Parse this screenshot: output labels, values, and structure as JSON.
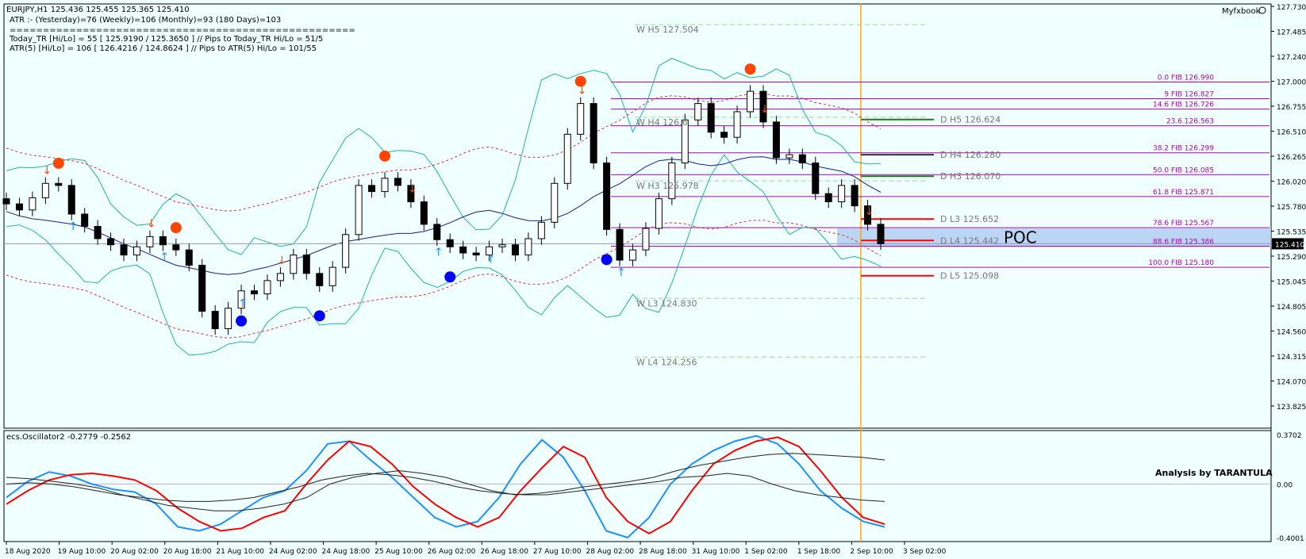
{
  "header": {
    "symbol_line": "EURJPY,H1  125.436 125.455 125.365 125.410",
    "atr_line": "ATR :- (Yesterday)=76      (Weekly)=106      (Monthly)=93      (180 Days)=103",
    "separator": "====================================================",
    "today_tr_line": "Today_TR [Hi/Lo] = 55 [ 125.9190 / 125.3650 ]  // Pips to Today_TR Hi/Lo  = 51/5",
    "atr5_line": "ATR(5)      [Hi/Lo] = 106 [ 126.4216 / 124.8624 ]  //  Pips to ATR(5) Hi/Lo      = 101/55"
  },
  "brand": "Myfxbook",
  "oscillator_label": "ecs.Oscillator2 -0.2779 -0.2562",
  "analysis_label": "Analysis by TARANTULA",
  "poc_label": "POC",
  "current_price": "125.410",
  "colors": {
    "background": "#f0ffff",
    "up_arrow": "#1e90ff",
    "down_arrow": "#ff4500",
    "fib": "#b000b0",
    "pivot_line": "#ff0000",
    "vline": "#ffa500",
    "blue_series": "#1e90ff",
    "red_series": "#ff0000"
  },
  "chart_data": [
    {
      "type": "candlestick",
      "price_axis": {
        "ylim": [
          123.825,
          127.73
        ],
        "tick_labels": [
          "127.730",
          "127.485",
          "127.240",
          "127.000",
          "126.755",
          "126.510",
          "126.265",
          "126.020",
          "125.780",
          "125.535",
          "125.290",
          "125.045",
          "124.805",
          "124.560",
          "124.315",
          "124.070",
          "123.825"
        ]
      },
      "time_axis": {
        "tick_labels": [
          "18 Aug 2020",
          "19 Aug 10:00",
          "20 Aug 02:00",
          "20 Aug 18:00",
          "21 Aug 10:00",
          "24 Aug 02:00",
          "24 Aug 18:00",
          "25 Aug 10:00",
          "26 Aug 02:00",
          "26 Aug 18:00",
          "27 Aug 10:00",
          "28 Aug 02:00",
          "28 Aug 18:00",
          "31 Aug 10:00",
          "1 Sep 02:00",
          "1 Sep 18:00",
          "2 Sep 10:00",
          "3 Sep 02:00"
        ]
      },
      "close_series": [
        125.8,
        125.74,
        125.86,
        126.0,
        125.98,
        125.7,
        125.58,
        125.46,
        125.4,
        125.3,
        125.38,
        125.48,
        125.4,
        125.35,
        125.2,
        124.75,
        124.58,
        124.78,
        124.95,
        124.92,
        125.05,
        125.12,
        125.3,
        125.12,
        125.0,
        125.18,
        125.5,
        125.98,
        125.92,
        126.05,
        125.98,
        125.82,
        125.6,
        125.45,
        125.38,
        125.32,
        125.3,
        125.38,
        125.4,
        125.3,
        125.46,
        125.62,
        126.0,
        126.48,
        126.78,
        126.2,
        125.55,
        125.25,
        125.35,
        125.56,
        125.85,
        126.2,
        126.62,
        126.78,
        126.5,
        126.45,
        126.7,
        126.9,
        126.6,
        126.25,
        126.28,
        126.2,
        125.9,
        125.82,
        125.98,
        125.78,
        125.6,
        125.41
      ],
      "ohlc_header": {
        "open": 125.436,
        "high": 125.455,
        "low": 125.365,
        "close": 125.41
      },
      "fibonacci_levels": [
        {
          "label": "0.0 FIB 126.990",
          "value": 126.99
        },
        {
          "label": "9 FIB 126.827",
          "value": 126.827
        },
        {
          "label": "14.6 FIB 126.726",
          "value": 126.726
        },
        {
          "label": "23.6  126.563",
          "value": 126.563
        },
        {
          "label": "38.2 FIB 126.299",
          "value": 126.299
        },
        {
          "label": "50.0 FIB 126.085",
          "value": 126.085
        },
        {
          "label": "61.8 FIB 125.871",
          "value": 125.871
        },
        {
          "label": "78.6 FIB 125.567",
          "value": 125.567
        },
        {
          "label": "88.6 FIB 125.386",
          "value": 125.386
        },
        {
          "label": "100.0 FIB 125.180",
          "value": 125.18
        }
      ],
      "weekly_pivots": [
        {
          "label": "W  H5 127.504",
          "value": 127.504
        },
        {
          "label": "W  H4 126.6",
          "value": 126.6
        },
        {
          "label": "W  H3 125.978",
          "value": 125.978
        },
        {
          "label": "W  L3 124.830",
          "value": 124.83
        },
        {
          "label": "W  L4 124.256",
          "value": 124.256
        }
      ],
      "daily_pivots": [
        {
          "label": "D  H5 126.624",
          "value": 126.624
        },
        {
          "label": "D  H4 126.280",
          "value": 126.28
        },
        {
          "label": "D  H3 126.070",
          "value": 126.07
        },
        {
          "label": "D  L3 125.652",
          "value": 125.652
        },
        {
          "label": "D  L4 125.442",
          "value": 125.442
        },
        {
          "label": "D  L5 125.098",
          "value": 125.098
        }
      ],
      "poc": {
        "low": 125.38,
        "high": 125.56
      }
    },
    {
      "type": "line",
      "name": "ecs.Oscillator2",
      "ylim": [
        -0.4001,
        0.3702
      ],
      "tick_labels": [
        "0.3702",
        "0.00",
        "-0.4001"
      ],
      "series": [
        {
          "name": "blue",
          "color": "#1e90ff",
          "values": [
            -0.1,
            0.02,
            0.09,
            0.06,
            0.0,
            -0.04,
            -0.06,
            -0.15,
            -0.32,
            -0.35,
            -0.3,
            -0.2,
            -0.1,
            -0.05,
            0.1,
            0.3,
            0.32,
            0.18,
            0.05,
            -0.1,
            -0.25,
            -0.32,
            -0.28,
            -0.1,
            0.15,
            0.33,
            0.2,
            -0.05,
            -0.35,
            -0.4,
            -0.25,
            0.0,
            0.15,
            0.25,
            0.32,
            0.36,
            0.3,
            0.15,
            -0.05,
            -0.18,
            -0.28,
            -0.32
          ]
        },
        {
          "name": "red",
          "color": "#ff0000",
          "values": [
            -0.15,
            -0.05,
            0.03,
            0.07,
            0.08,
            0.06,
            0.03,
            -0.05,
            -0.18,
            -0.28,
            -0.35,
            -0.33,
            -0.25,
            -0.2,
            0.0,
            0.18,
            0.32,
            0.28,
            0.15,
            -0.02,
            -0.15,
            -0.25,
            -0.32,
            -0.25,
            -0.05,
            0.12,
            0.28,
            0.2,
            -0.1,
            -0.28,
            -0.37,
            -0.28,
            -0.05,
            0.15,
            0.25,
            0.32,
            0.35,
            0.28,
            0.1,
            -0.1,
            -0.25,
            -0.3
          ]
        },
        {
          "name": "black-1",
          "color": "#222222",
          "values": [
            0.05,
            0.04,
            0.02,
            0.0,
            -0.03,
            -0.08,
            -0.12,
            -0.16,
            -0.18,
            -0.2,
            -0.2,
            -0.18,
            -0.15,
            -0.1,
            0.0,
            0.05,
            0.08,
            0.1,
            0.08,
            0.05,
            0.0,
            -0.05,
            -0.08,
            -0.07,
            -0.05,
            -0.02,
            0.0,
            0.02,
            0.05,
            0.1,
            0.14,
            0.17,
            0.2,
            0.22,
            0.23,
            0.22,
            0.21,
            0.2,
            0.18
          ]
        },
        {
          "name": "black-2",
          "color": "#222222",
          "values": [
            0.0,
            0.01,
            0.0,
            -0.02,
            -0.05,
            -0.08,
            -0.1,
            -0.12,
            -0.13,
            -0.13,
            -0.12,
            -0.1,
            -0.06,
            -0.02,
            0.03,
            0.06,
            0.08,
            0.07,
            0.05,
            0.02,
            -0.02,
            -0.05,
            -0.07,
            -0.08,
            -0.08,
            -0.06,
            -0.04,
            -0.02,
            0.0,
            0.02,
            0.05,
            0.06,
            0.08,
            0.06,
            0.0,
            -0.05,
            -0.08,
            -0.1,
            -0.12,
            -0.13
          ]
        }
      ]
    }
  ]
}
